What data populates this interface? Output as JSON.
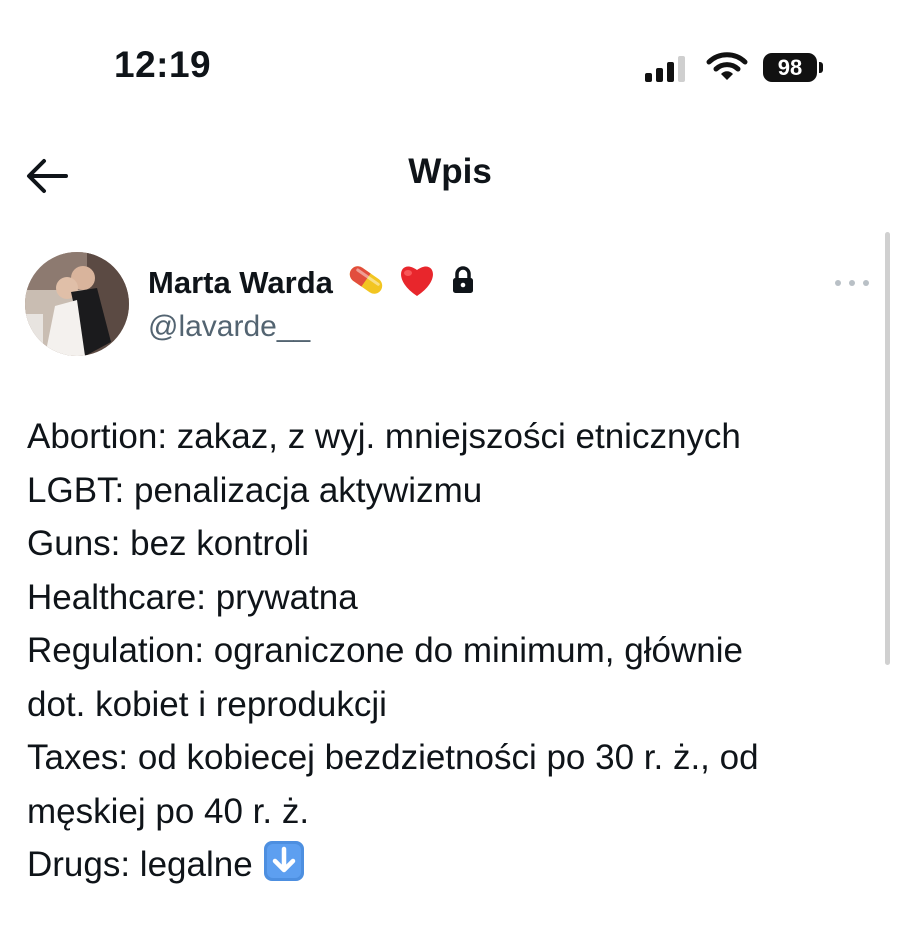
{
  "status_bar": {
    "time": "12:19",
    "battery": "98"
  },
  "nav": {
    "title": "Wpis",
    "back_icon": "arrow-left-icon"
  },
  "post": {
    "author": {
      "display_name": "Marta Warda",
      "handle": "@lavarde__",
      "name_emojis": [
        "pill-icon",
        "heart-icon",
        "lock-icon"
      ]
    },
    "lines": [
      "Abortion: zakaz, z wyj. mniejszości etnicznych",
      "LGBT: penalizacja aktywizmu",
      "Guns: bez kontroli",
      "Healthcare: prywatna",
      "Regulation: ograniczone do minimum, głównie",
      "dot. kobiet i reprodukcji",
      "Taxes: od kobiecej bezdzietności po 30 r. ż., od",
      "męskiej po 40 r. ż.",
      "Drugs: legalne"
    ],
    "trailing_emoji": "down-arrow-icon"
  },
  "colors": {
    "text": "#0f1419",
    "secondary_text": "#536471",
    "background": "#ffffff"
  }
}
